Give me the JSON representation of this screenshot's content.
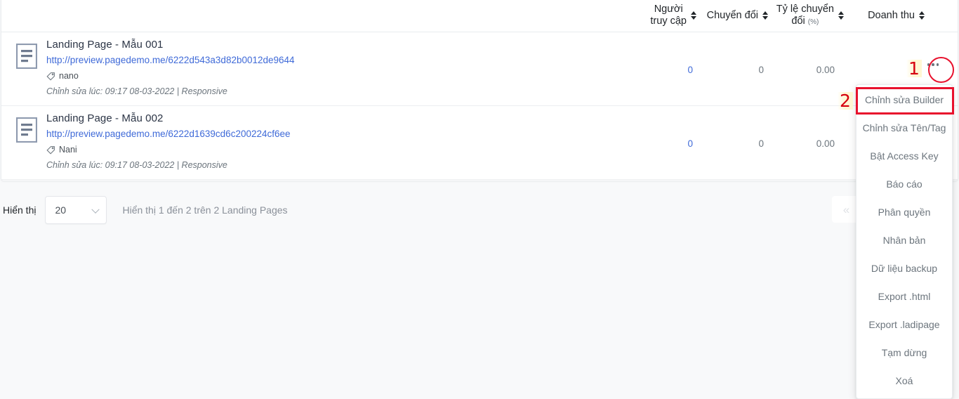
{
  "table": {
    "columns": [
      {
        "id": "visitors",
        "label_line1": "Người",
        "label_line2": "truy cập",
        "sortable": true
      },
      {
        "id": "conversions",
        "label_line1": "Chuyển đổi",
        "label_line2": "",
        "sortable": true
      },
      {
        "id": "conversion_rate",
        "label_line1": "Tỷ lệ chuyển",
        "label_line2": "đổi",
        "unit": "(%)",
        "sortable": true
      },
      {
        "id": "revenue",
        "label_line1": "Doanh thu",
        "label_line2": "",
        "sortable": true
      }
    ],
    "rows": [
      {
        "icon": "document-icon",
        "title": "Landing Page - Mẫu 001",
        "url": "http://preview.pagedemo.me/6222d543a3d82b0012de9644",
        "tag_icon": "tag-icon",
        "tag": "nano",
        "meta": "Chỉnh sửa lúc: 09:17 08-03-2022 | Responsive",
        "visitors": "0",
        "conversions": "0",
        "conversion_rate": "0.00",
        "revenue": "",
        "actions_icon": "ellipsis-icon"
      },
      {
        "icon": "document-icon",
        "title": "Landing Page - Mẫu 002",
        "url": "http://preview.pagedemo.me/6222d1639cd6c200224cf6ee",
        "tag_icon": "tag-icon",
        "tag": "Nani",
        "meta": "Chỉnh sửa lúc: 09:17 08-03-2022 | Responsive",
        "visitors": "0",
        "conversions": "0",
        "conversion_rate": "0.00",
        "revenue": "",
        "actions_icon": "ellipsis-icon"
      }
    ]
  },
  "footer": {
    "show_label": "Hiển thị",
    "page_size": "20",
    "page_size_chevron": "chevron-down-icon",
    "summary": "Hiển thị 1 đến 2 trên 2 Landing Pages",
    "pager_prev_icon": "double-chevron-left-icon",
    "pager_prev_glyph": "«"
  },
  "dropdown": {
    "items": [
      {
        "label": "Chỉnh sửa Builder",
        "highlighted": true
      },
      {
        "label": "Chỉnh sửa Tên/Tag",
        "highlighted": false
      },
      {
        "label": "Bật Access Key",
        "highlighted": false
      },
      {
        "label": "Báo cáo",
        "highlighted": false
      },
      {
        "label": "Phân quyền",
        "highlighted": false
      },
      {
        "label": "Nhân bản",
        "highlighted": false
      },
      {
        "label": "Dữ liệu backup",
        "highlighted": false
      },
      {
        "label": "Export .html",
        "highlighted": false
      },
      {
        "label": "Export .ladipage",
        "highlighted": false
      },
      {
        "label": "Tạm dừng",
        "highlighted": false
      },
      {
        "label": "Xoá",
        "highlighted": false
      }
    ]
  },
  "annotations": {
    "step_one": "1",
    "step_two": "2",
    "color": "#e8112d"
  },
  "colors": {
    "link": "#3f6ad8",
    "page_background": "#f8f9fa",
    "card_background": "#ffffff",
    "border": "#e9ecef",
    "muted_text": "#6c757d",
    "annotation_red": "#e8112d"
  }
}
